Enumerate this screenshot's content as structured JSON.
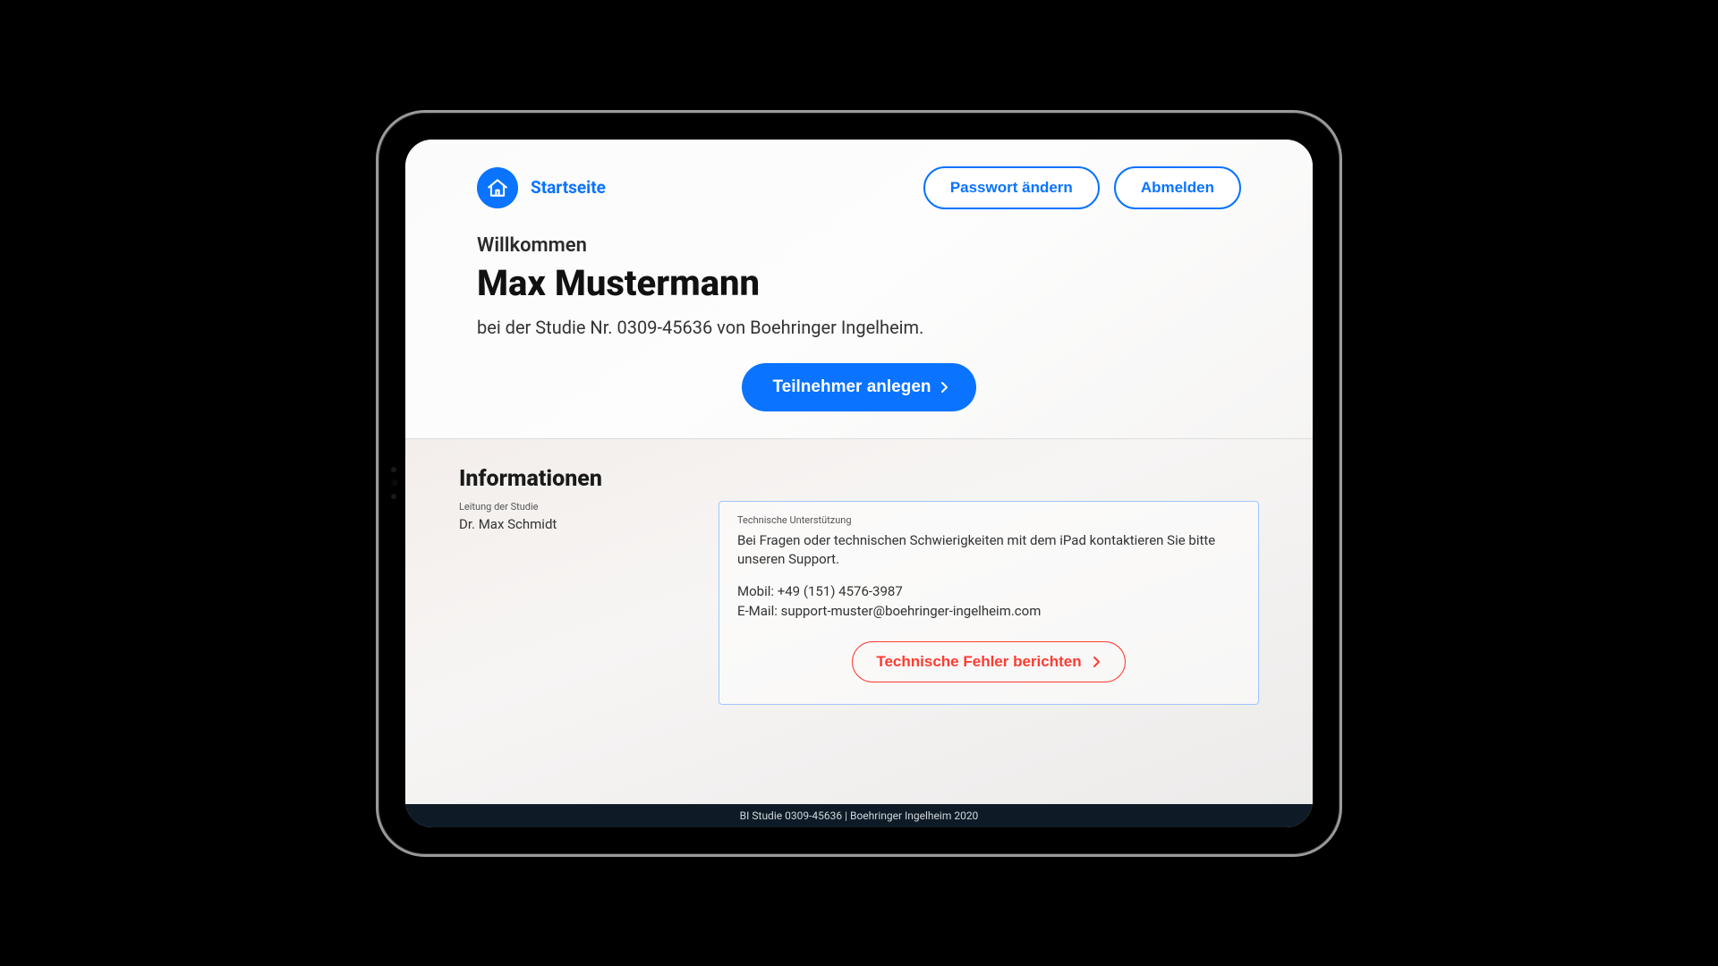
{
  "header": {
    "home_label": "Startseite",
    "change_password": "Passwort ändern",
    "logout": "Abmelden"
  },
  "welcome": {
    "greeting": "Willkommen",
    "user_name": "Max Mustermann",
    "study_line": "bei der Studie Nr. 0309-45636 von Boehringer Ingelheim.",
    "primary_action": "Teilnehmer anlegen"
  },
  "info": {
    "section_title": "Informationen",
    "lead_label": "Leitung der Studie",
    "lead_name": "Dr. Max Schmidt",
    "support_label": "Technische Unterstützung",
    "support_text": "Bei Fragen oder technischen Schwierigkeiten mit dem iPad kontaktieren Sie bitte unseren Support.",
    "mobile_line": "Mobil: +49 (151) 4576-3987",
    "email_line": "E-Mail: support-muster@boehringer-ingelheim.com",
    "report_button": "Technische Fehler berichten"
  },
  "footer": {
    "text": "BI Studie 0309-45636 | Boehringer Ingelheim 2020"
  }
}
